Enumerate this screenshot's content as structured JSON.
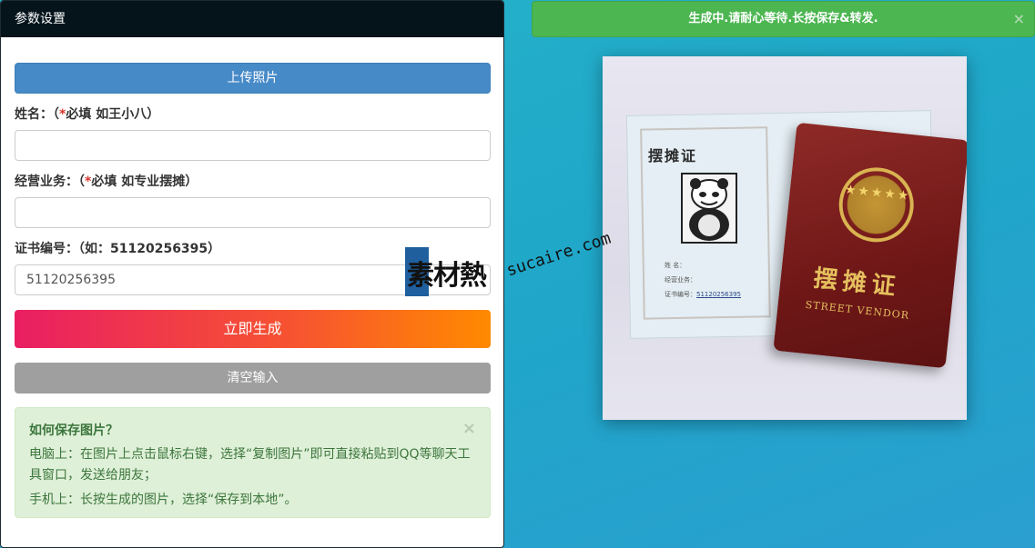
{
  "panel": {
    "title": "参数设置",
    "upload_label": "上传照片",
    "name_label_prefix": "姓名：（",
    "name_label_req": "*",
    "name_label_suffix": "必填 如王小八）",
    "business_label_prefix": "经营业务：（",
    "business_label_req": "*",
    "business_label_suffix": "必填 如专业摆摊）",
    "cert_label": "证书编号：（如：51120256395）",
    "name_value": "",
    "business_value": "",
    "cert_value": "51120256395",
    "generate_label": "立即生成",
    "clear_label": "清空输入",
    "help": {
      "title": "如何保存图片？",
      "pc_text": "电脑上：在图片上点击鼠标右键，选择“复制图片”即可直接粘贴到QQ等聊天工具窗口，发送给朋友；",
      "mobile_text": "手机上：长按生成的图片，选择“保存到本地”。",
      "close_glyph": "×"
    }
  },
  "notice": {
    "text": "生成中.请耐心等待.长按保存&转发.",
    "close_glyph": "×"
  },
  "certificate": {
    "inner_title": "摆摊证",
    "line1": "姓    名：",
    "line2": "经营业务：",
    "line3_label": "证书编号：",
    "line3_value": "51120256395",
    "cover_title": "摆摊证",
    "cover_subtitle": "STREET VENDOR",
    "cover_stars": "★★★★★"
  },
  "watermark": {
    "brand": "素材熱",
    "url": "sucaire.com"
  },
  "colors": {
    "header_bg": "#05141b",
    "upload_bg": "#478ac8",
    "notice_bg": "#4cb651",
    "help_bg": "#dff0d8",
    "clear_bg": "#9f9f9f",
    "page_bg": "#26b3c9"
  }
}
